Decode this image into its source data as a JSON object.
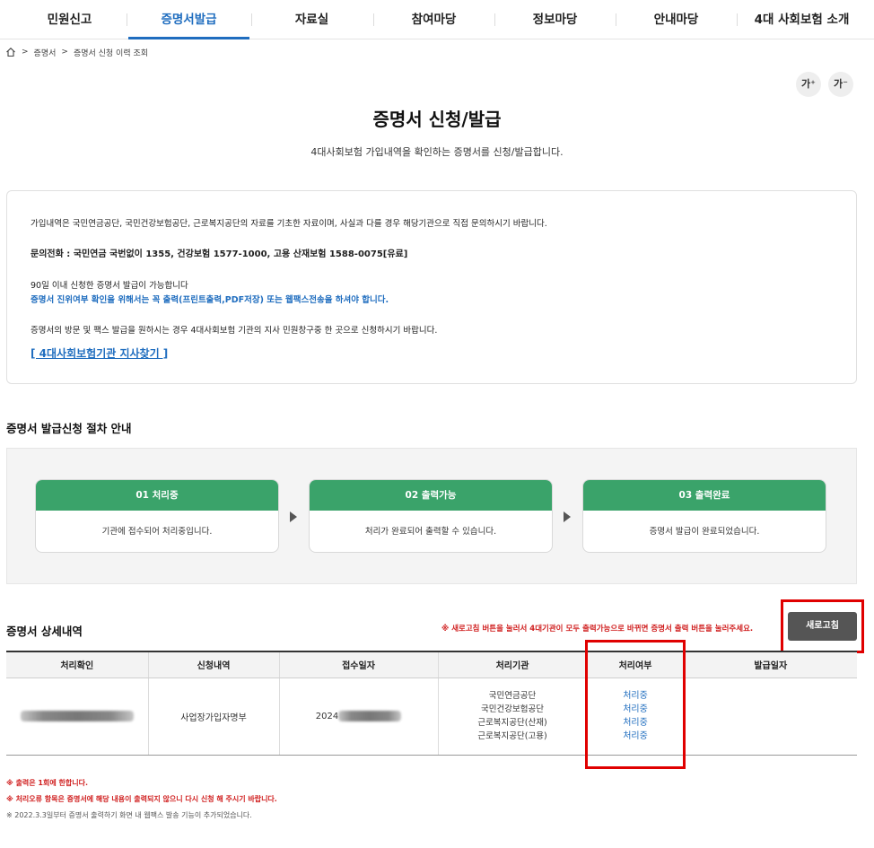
{
  "nav": {
    "items": [
      "민원신고",
      "증명서발급",
      "자료실",
      "참여마당",
      "정보마당",
      "안내마당",
      "4대 사회보험 소개"
    ],
    "active_index": 1,
    "active_color": "#1f6dbf"
  },
  "breadcrumb": {
    "home_icon": "home-icon",
    "items": [
      "증명서",
      "증명서 신청 이력 조회"
    ]
  },
  "font_controls": {
    "increase": "가⁺",
    "decrease": "가⁻"
  },
  "header": {
    "title": "증명서 신청/발급",
    "subtitle": "4대사회보험 가입내역을 확인하는 증명서를 신청/발급합니다."
  },
  "notice": {
    "line1": "가입내역은 국민연금공단, 국민건강보험공단, 근로복지공단의 자료를 기초한 자료이며, 사실과 다를 경우 해당기관으로 직접 문의하시기 바랍니다.",
    "line2": "문의전화 : 국민연금 국번없이 1355, 건강보험 1577-1000, 고용 산재보험 1588-0075[유료]",
    "line3": "90일 이내 신청한 증명서 발급이 가능합니다",
    "line4": "증명서 진위여부 확인을 위해서는 꼭 출력(프린트출력,PDF저장) 또는 웹팩스전송을 하셔야 합니다.",
    "line5": "증명서의 방문 및 팩스 발급을 원하시는 경우 4대사회보험 기관의 지사 민원창구중 한 곳으로 신청하시기 바랍니다.",
    "link": "[ 4대사회보험기관 지사찾기 ]"
  },
  "process": {
    "heading": "증명서 발급신청 절차 안내",
    "steps": [
      {
        "title": "01 처리중",
        "desc": "기관에 접수되어 처리중입니다."
      },
      {
        "title": "02 출력가능",
        "desc": "처리가 완료되어 출력할 수 있습니다."
      },
      {
        "title": "03 출력완료",
        "desc": "증명서 발급이 완료되었습니다."
      }
    ],
    "step_color": "#3aa36a"
  },
  "detail": {
    "heading": "증명서 상세내역",
    "warning": "※ 새로고침 버튼을 눌러서 4대기관이 모두 출력가능으로 바뀌면 증명서 출력 버튼을 눌러주세요.",
    "refresh_label": "새로고침",
    "columns": [
      "처리확인",
      "신청내역",
      "접수일자",
      "처리기관",
      "처리여부",
      "발급일자"
    ],
    "row": {
      "confirm": "",
      "request": "사업장가입자명부",
      "date_prefix": "2024",
      "orgs": [
        "국민연금공단",
        "국민건강보험공단",
        "근로복지공단(산재)",
        "근로복지공단(고용)"
      ],
      "statuses": [
        "처리중",
        "처리중",
        "처리중",
        "처리중"
      ],
      "issue_date": ""
    }
  },
  "footnotes": {
    "f1": "※ 출력은 1회에 한합니다.",
    "f2": "※ 처리오류 항목은 증명서에 해당 내용이 출력되지 않으니 다시 신청 해 주시기 바랍니다.",
    "f3": "※ 2022.3.3일부터 증명서 출력하기 화면 내 웹팩스 발송 기능이 추가되었습니다."
  }
}
